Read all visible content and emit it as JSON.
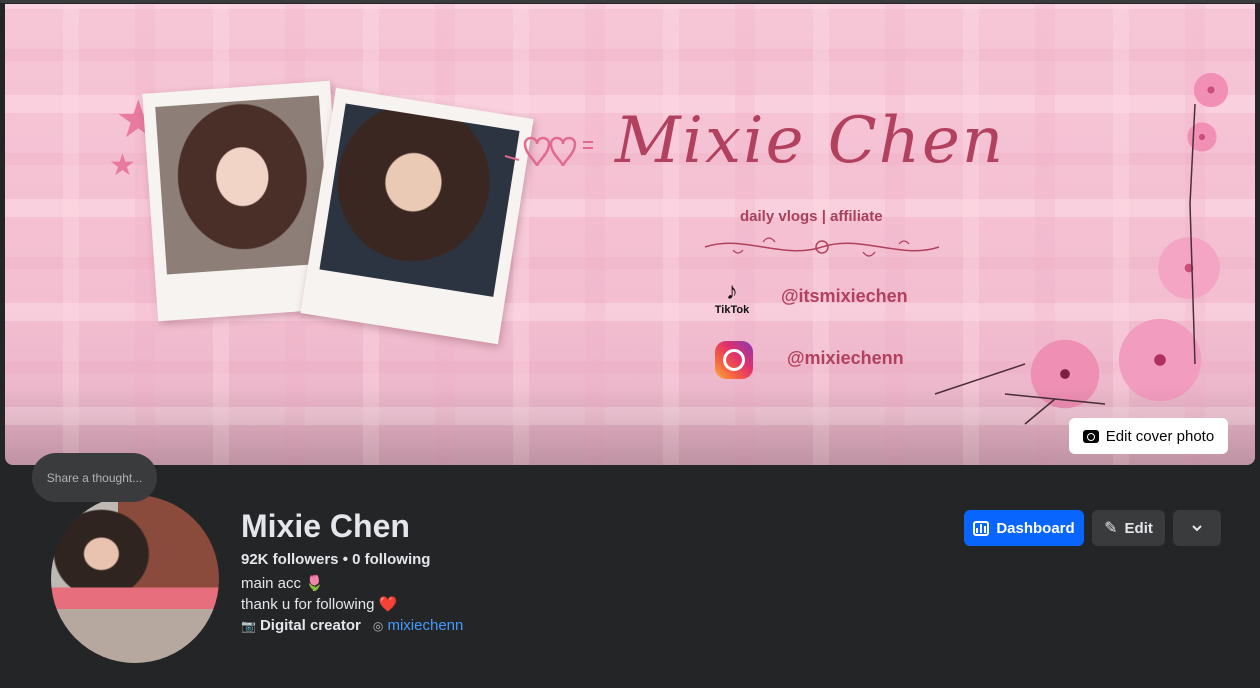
{
  "cover": {
    "title_script": "Mixie Chen",
    "subtitle": "daily vlogs | affiliate",
    "tiktok_label": "TikTok",
    "tiktok_handle": "@itsmixiechen",
    "instagram_handle": "@mixiechenn",
    "edit_cover_label": "Edit cover photo"
  },
  "avatar": {
    "thought_placeholder": "Share a thought..."
  },
  "profile": {
    "name": "Mixie Chen",
    "followers": "92K followers",
    "separator": " • ",
    "following": "0 following",
    "bio_line1": "main acc 🌷",
    "bio_line2": "thank u for following ❤️",
    "category": "Digital creator",
    "instagram_link": "mixiechenn"
  },
  "actions": {
    "dashboard_label": "Dashboard",
    "edit_label": "Edit"
  },
  "colors": {
    "accent": "#0866ff",
    "link": "#4599ff",
    "background": "#242526",
    "cover_text": "#b2405f"
  },
  "icons": [
    "camera-icon",
    "dashboard-icon",
    "pencil-icon",
    "chevron-down-icon",
    "camera-small-icon",
    "instagram-small-icon",
    "tiktok-icon",
    "instagram-icon"
  ]
}
